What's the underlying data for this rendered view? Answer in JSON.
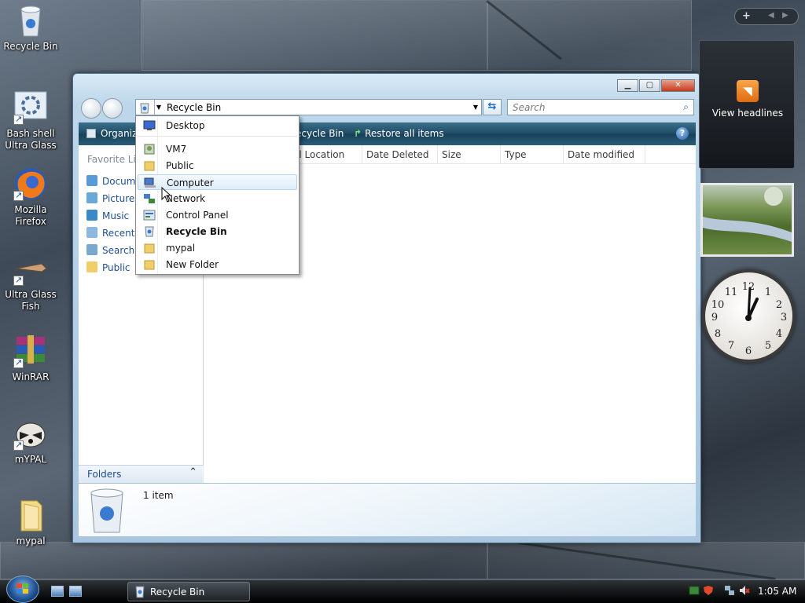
{
  "desktop": {
    "icons": [
      {
        "label": "Recycle Bin"
      },
      {
        "label": "Bash shell Ultra Glass"
      },
      {
        "label": "Mozilla Firefox"
      },
      {
        "label": "Ultra Glass Fish"
      },
      {
        "label": "WinRAR"
      },
      {
        "label": "mYPAL"
      },
      {
        "label": "mypal"
      }
    ]
  },
  "window": {
    "address": "Recycle Bin",
    "search_placeholder": "Search",
    "toolbar": {
      "organize": "Organiz",
      "empty": "ecycle Bin",
      "restore": "Restore all items",
      "help": "?"
    },
    "nav": {
      "header": "Favorite Lin",
      "links": [
        "Docume",
        "Pictures",
        "Music",
        "Recently",
        "Searche",
        "Public"
      ],
      "folders": "Folders"
    },
    "columns": [
      "al Location",
      "Date Deleted",
      "Size",
      "Type",
      "Date modified"
    ],
    "details": {
      "count": "1 item"
    },
    "controls": {
      "min": "▁",
      "max": "▢",
      "close": "✕"
    }
  },
  "dropdown": {
    "items": [
      {
        "label": "Desktop",
        "bold": false
      },
      {
        "label": "VM7",
        "bold": false
      },
      {
        "label": "Public",
        "bold": false
      },
      {
        "label": "Computer",
        "bold": false
      },
      {
        "label": "Network",
        "bold": false
      },
      {
        "label": "Control Panel",
        "bold": false
      },
      {
        "label": "Recycle Bin",
        "bold": true
      },
      {
        "label": "mypal",
        "bold": false
      },
      {
        "label": "New Folder",
        "bold": false
      }
    ],
    "highlighted": "Computer"
  },
  "gadgets": {
    "add": "+",
    "feed_label": "View headlines"
  },
  "taskbar": {
    "task_label": "Recycle Bin",
    "time": "1:05 AM"
  },
  "colors": {
    "toolbar": "#1f4a64",
    "link": "#1e4e8c",
    "highlight": "#deedf9"
  }
}
